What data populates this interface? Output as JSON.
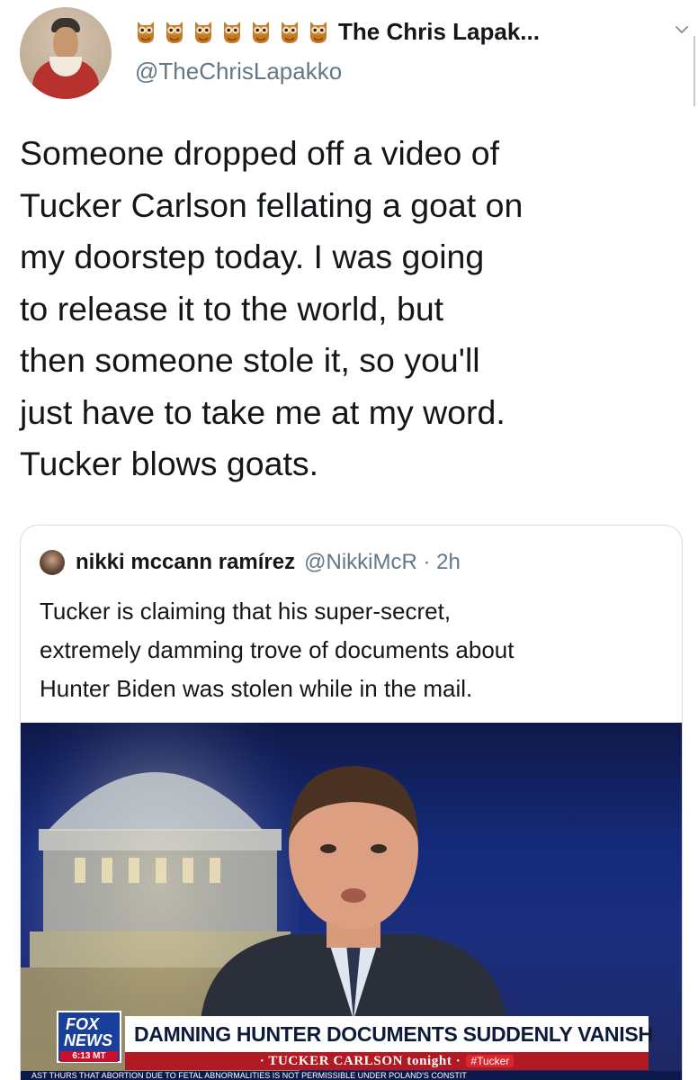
{
  "tweet": {
    "display_name": "The Chris Lapak...",
    "handle": "@TheChrisLapakko",
    "name_emoji": [
      "owl-icon",
      "owl-icon",
      "owl-icon",
      "owl-icon",
      "owl-icon",
      "owl-icon",
      "owl-icon"
    ],
    "body_lines": [
      "Someone dropped off a video of",
      "Tucker Carlson fellating a goat on",
      "my doorstep today. I was going",
      "to release it to the world, but",
      "then someone stole it, so you'll",
      "just have to take me at my word.",
      "Tucker blows goats."
    ]
  },
  "quoted_tweet": {
    "name": "nikki mccann ramírez",
    "handle_time": "@NikkiMcR · 2h",
    "text_lines": [
      "Tucker is claiming that his super-secret,",
      "extremely damming trove of documents about",
      "Hunter Biden was stolen while in the mail."
    ],
    "media": {
      "logo_line1": "FOX",
      "logo_line2": "NEWS",
      "logo_time": "6:13 MT",
      "headline": "DAMNING HUNTER DOCUMENTS SUDDENLY VANISH",
      "show_name": "· TUCKER CARLSON tonight ·",
      "show_tag": "#Tucker",
      "ticker": "AST THURS THAT ABORTION DUE TO FETAL ABNORMALITIES IS NOT PERMISSIBLE UNDER POLAND'S CONSTIT"
    }
  },
  "colors": {
    "text": "#14171a",
    "muted": "#657786",
    "border": "#d6dde3",
    "fox_red": "#b11a22",
    "fox_blue": "#1a3f9a"
  }
}
